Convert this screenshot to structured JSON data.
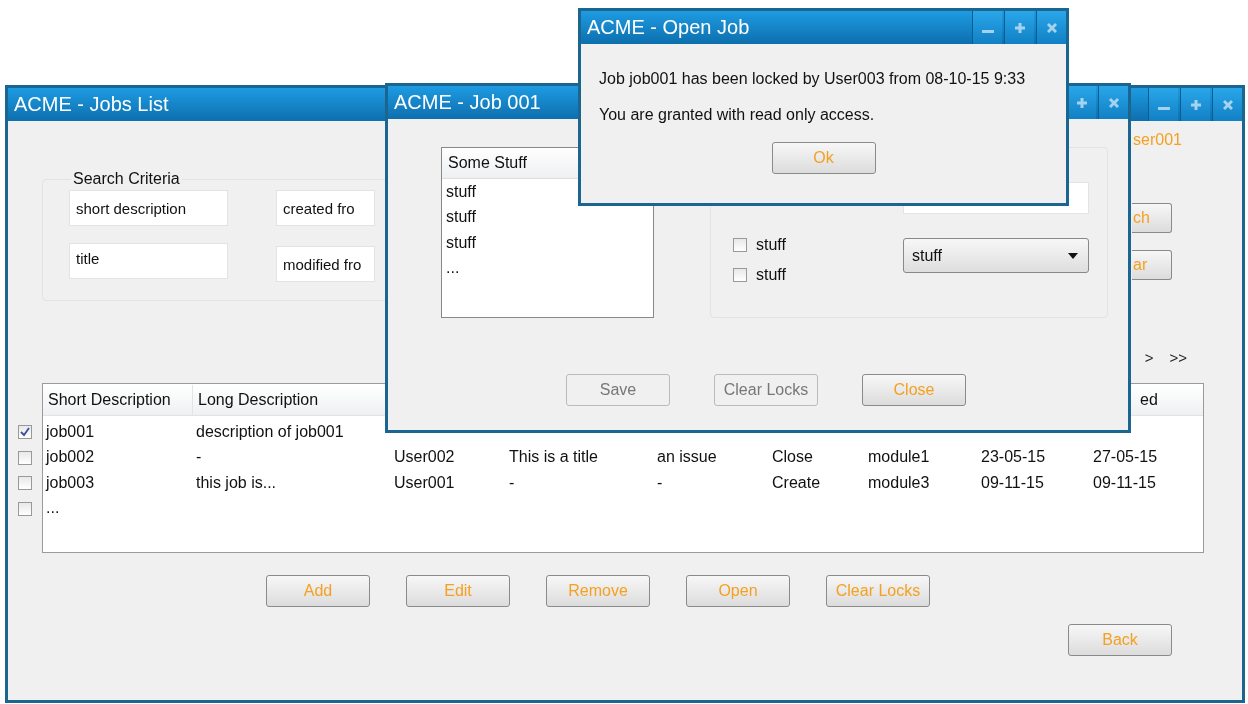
{
  "jobs_list_window": {
    "title": "ACME - Jobs List",
    "search_criteria": {
      "legend": "Search Criteria",
      "fields": [
        {
          "value": "short description"
        },
        {
          "value": "created fro"
        },
        {
          "value": "title"
        },
        {
          "value": "modified fro"
        }
      ]
    },
    "user": "ser001",
    "side_buttons": [
      "ch",
      "ar"
    ],
    "pagination": [
      ">",
      ">>"
    ],
    "table": {
      "columns": [
        "Short Description",
        "Long Description",
        null,
        null,
        null,
        null,
        null,
        null,
        "ed"
      ],
      "rows": [
        {
          "checked": true,
          "cells": [
            "job001",
            "description of job001",
            null,
            null,
            null,
            null,
            null,
            null,
            null
          ]
        },
        {
          "checked": false,
          "cells": [
            "job002",
            "-",
            "User002",
            "This is a title",
            "an issue",
            "Close",
            "module1",
            "23-05-15",
            "27-05-15"
          ]
        },
        {
          "checked": false,
          "cells": [
            "job003",
            "this job is...",
            "User001",
            "-",
            "-",
            "Create",
            "module3",
            "09-11-15",
            "09-11-15"
          ]
        },
        {
          "checked": false,
          "cells": [
            "...",
            null,
            null,
            null,
            null,
            null,
            null,
            null,
            null
          ]
        }
      ]
    },
    "buttons": [
      "Add",
      "Edit",
      "Remove",
      "Open",
      "Clear Locks"
    ],
    "back_button": "Back"
  },
  "job_window": {
    "title": "ACME - Job 001",
    "list": {
      "header": "Some Stuff",
      "items": [
        "stuff",
        "stuff",
        "stuff",
        "..."
      ]
    },
    "checkboxes": [
      {
        "label": "stuff",
        "checked": false
      },
      {
        "label": "stuff",
        "checked": false
      }
    ],
    "dropdown": {
      "value": "stuff"
    },
    "buttons": [
      {
        "label": "Save",
        "disabled": true
      },
      {
        "label": "Clear Locks",
        "disabled": true
      },
      {
        "label": "Close",
        "disabled": false
      }
    ]
  },
  "open_job_dialog": {
    "title": "ACME - Open Job",
    "lines": [
      "Job job001 has been locked by User003 from 08-10-15 9:33",
      "You are granted with read only access."
    ],
    "ok_button": "Ok"
  }
}
